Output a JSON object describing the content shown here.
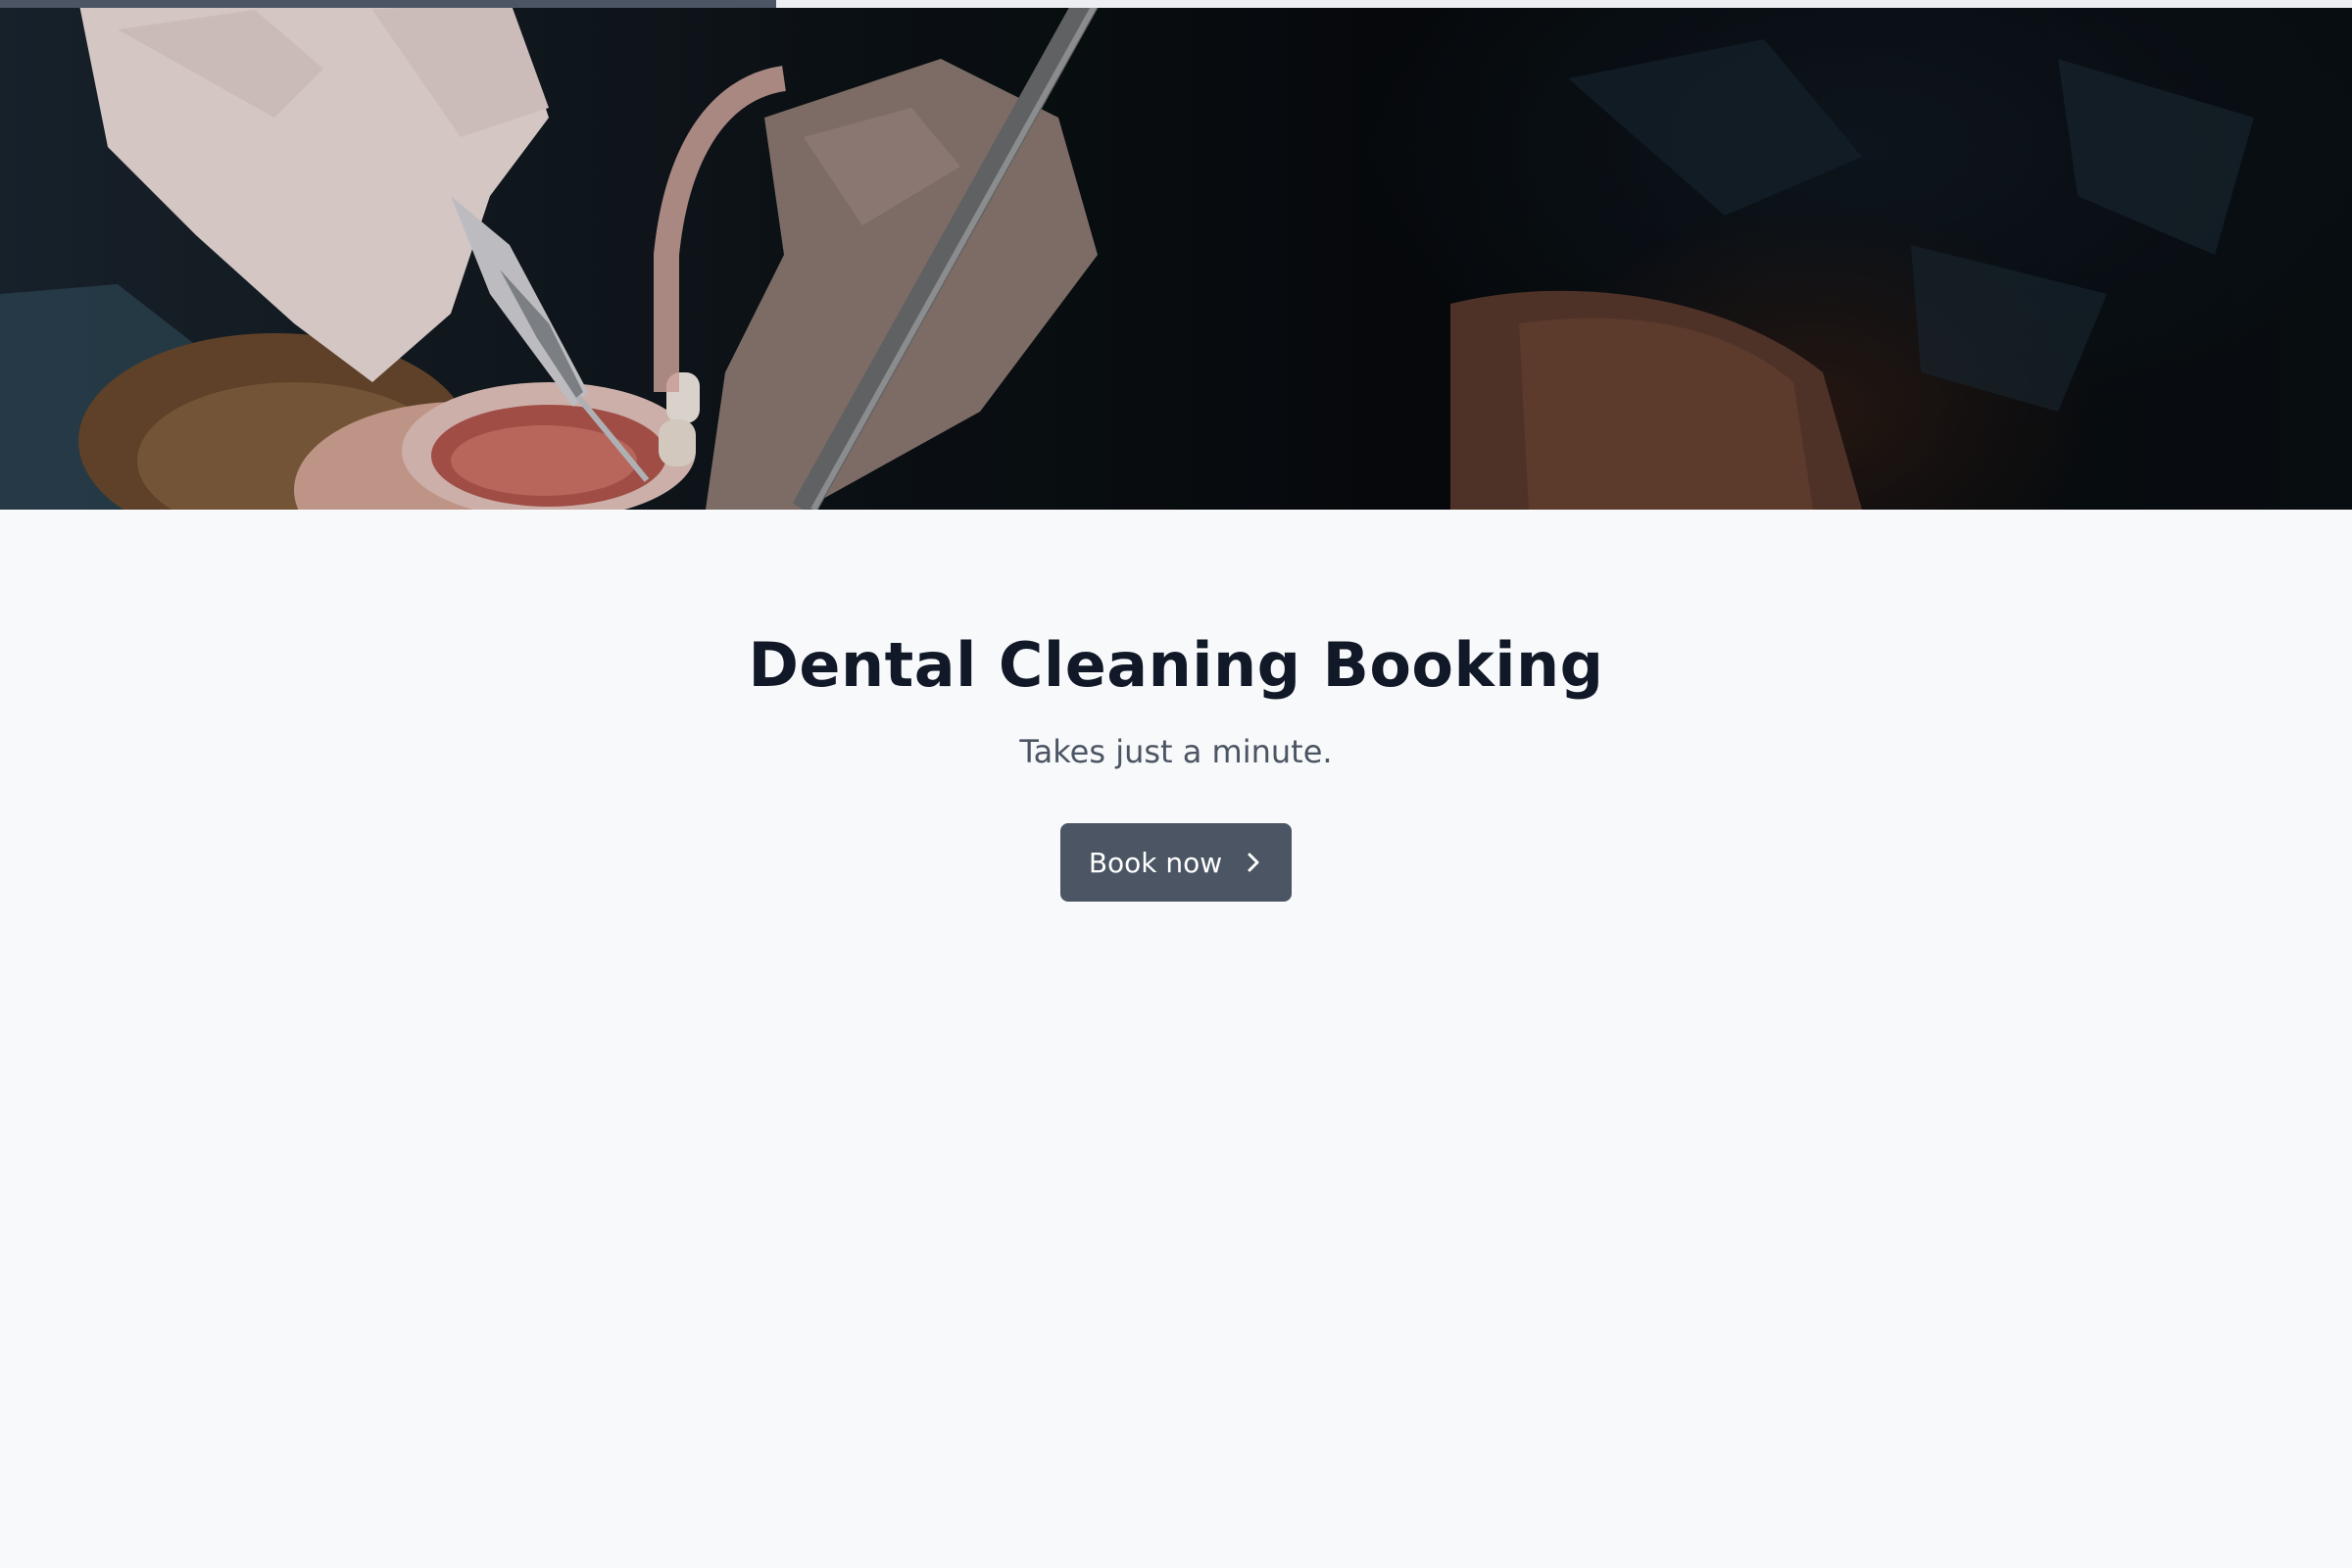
{
  "progress": {
    "value": 0.33
  },
  "hero": {
    "image": "dentist-cleaning-teeth-photo"
  },
  "main": {
    "title": "Dental Cleaning Booking",
    "subtitle": "Takes just a minute.",
    "cta_label": "Book now",
    "cta_icon": "chevron-right-icon"
  },
  "colors": {
    "page_bg": "#f8f9fb",
    "title": "#111827",
    "subtitle": "#4b5563",
    "button_bg": "#4b5563",
    "button_text": "#ffffff",
    "progress_fill": "#4b5563",
    "progress_track": "#eceef2"
  }
}
